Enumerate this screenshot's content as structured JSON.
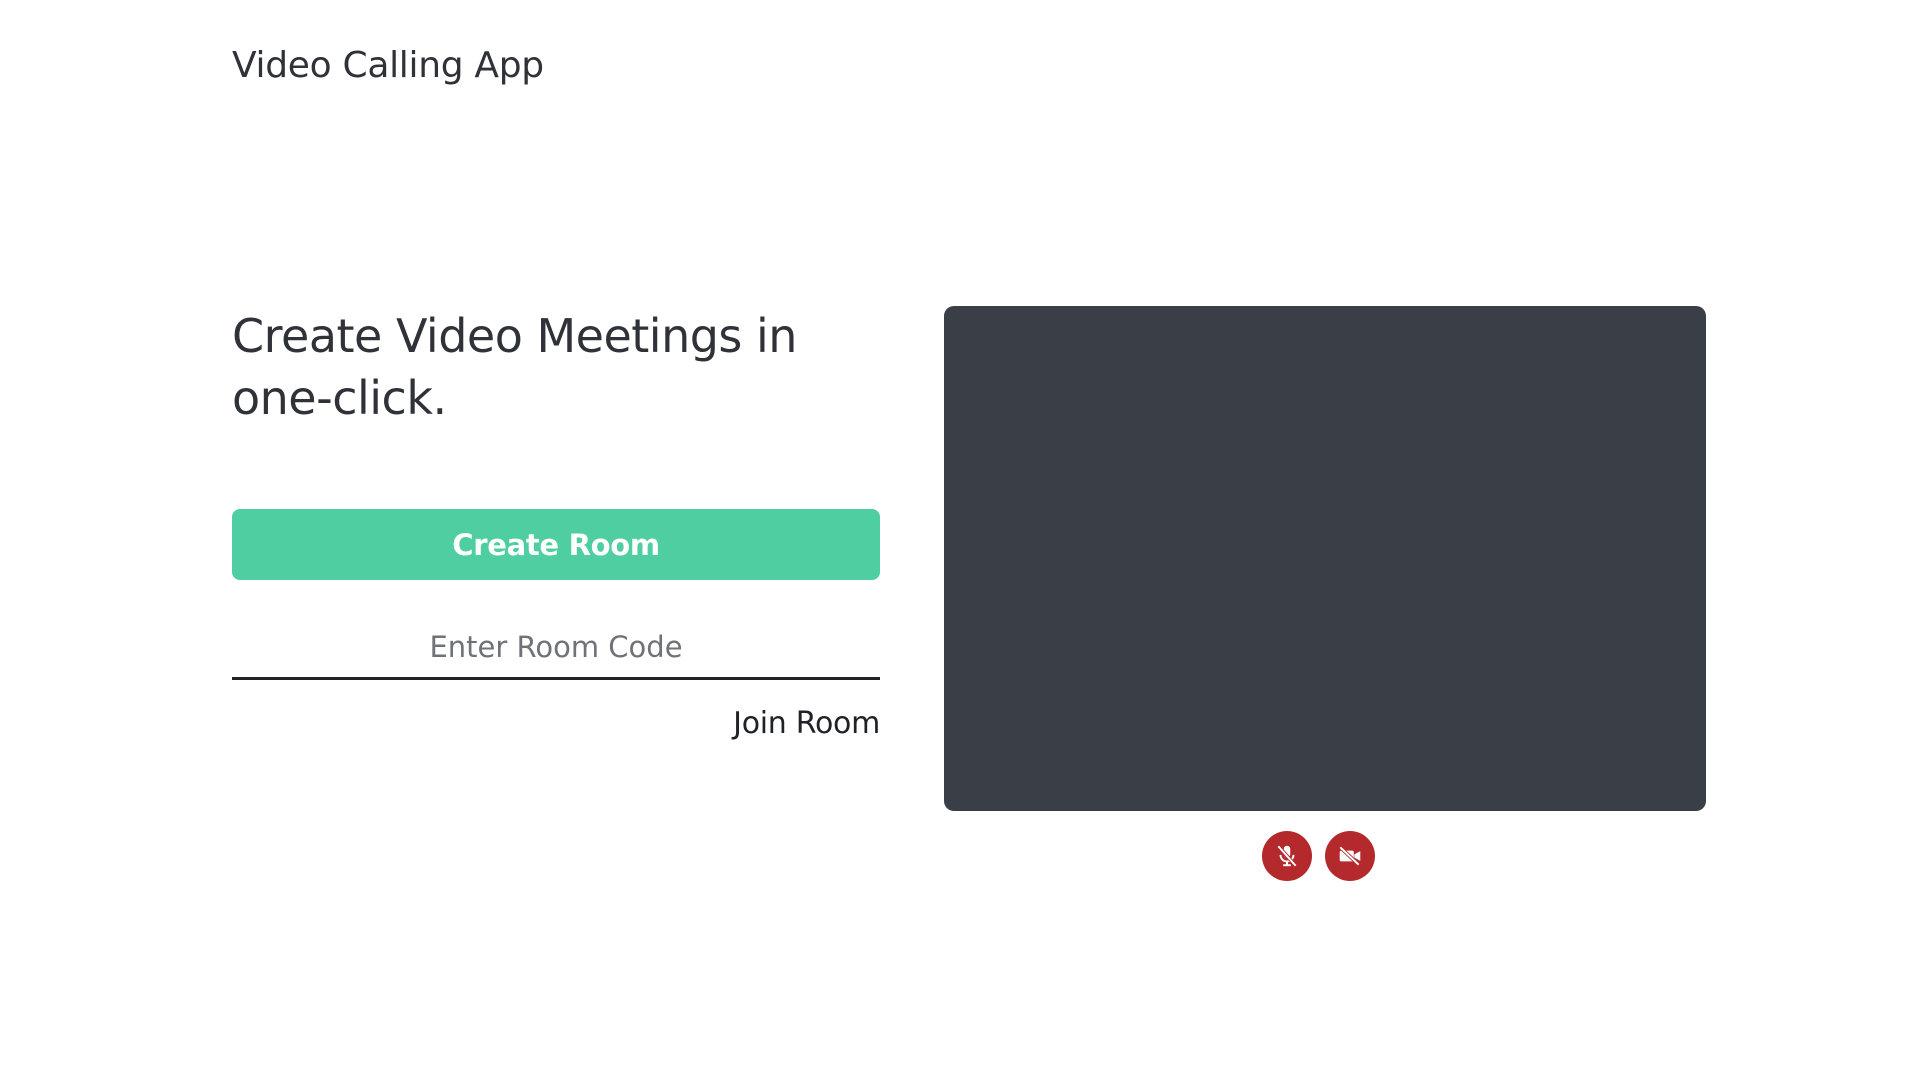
{
  "header": {
    "app_title": "Video Calling App"
  },
  "hero": {
    "headline": "Create Video Meetings in one-click."
  },
  "actions": {
    "create_room_label": "Create Room",
    "room_code_placeholder": "Enter Room Code",
    "room_code_value": "",
    "join_room_label": "Join Room"
  },
  "media_controls": {
    "mic_icon": "mic-off-icon",
    "camera_icon": "video-off-icon"
  },
  "colors": {
    "accent": "#4fcea2",
    "video_background": "#3a3e46",
    "control_off": "#b4292b"
  }
}
